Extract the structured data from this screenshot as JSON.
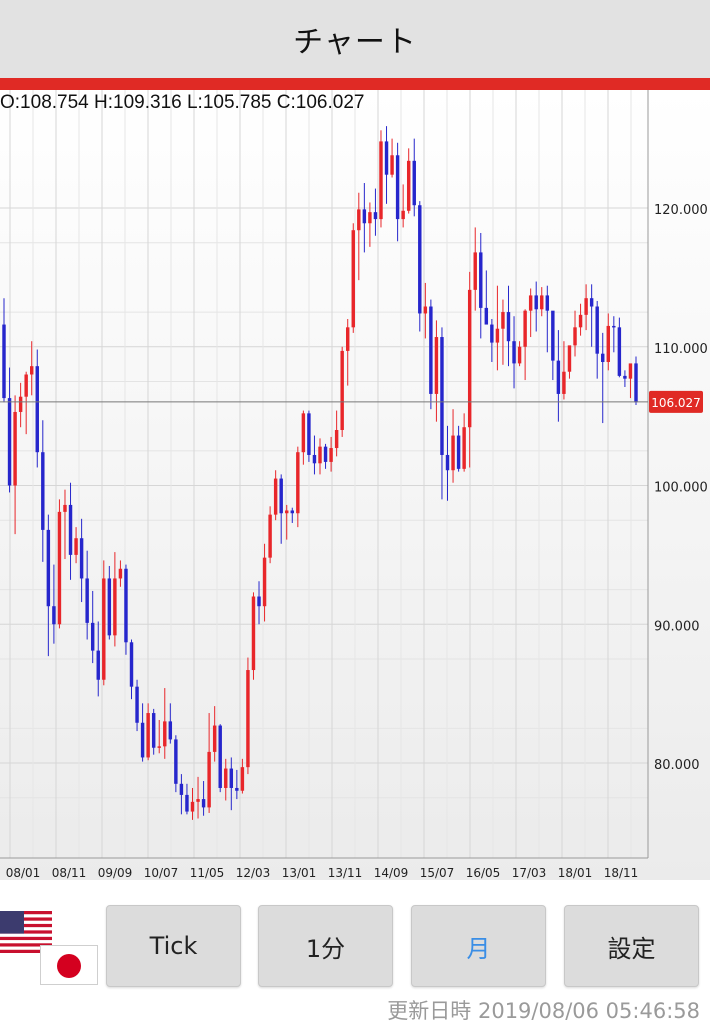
{
  "header": {
    "title": "チャート"
  },
  "ohlc_text": "O:108.754 H:109.316 L:105.785 C:106.027",
  "buttons": [
    {
      "label": "Tick",
      "active": false
    },
    {
      "label": "1分",
      "active": false
    },
    {
      "label": "月",
      "active": true
    },
    {
      "label": "設定",
      "active": false
    }
  ],
  "updated_text": "更新日時  2019/08/06 05:46:58",
  "flags": {
    "base": "us-flag-icon",
    "quote": "jp-flag-icon"
  },
  "colors": {
    "accent_red": "#e02a25",
    "up": "#e8262a",
    "down": "#2626cc",
    "active_button": "#3a8ee6"
  },
  "chart_data": {
    "type": "candlestick",
    "current_price_label": "106.027",
    "current_price": 106.027,
    "y_ticks": [
      "120.000",
      "110.000",
      "100.000",
      "90.000",
      "80.000"
    ],
    "y_tick_values": [
      120,
      110,
      100,
      90,
      80
    ],
    "ylim": [
      73.8,
      127
    ],
    "x_tick_labels": [
      "08/01",
      "08/11",
      "09/09",
      "10/07",
      "11/05",
      "12/03",
      "13/01",
      "13/11",
      "14/09",
      "15/07",
      "16/05",
      "17/03",
      "18/01",
      "18/11"
    ],
    "grid": true,
    "candles": [
      [
        111.6,
        113.5,
        106.0,
        106.3
      ],
      [
        106.3,
        108.5,
        99.5,
        100.0
      ],
      [
        100.0,
        106.5,
        96.5,
        105.3
      ],
      [
        105.3,
        107.4,
        104.2,
        106.4
      ],
      [
        106.4,
        108.2,
        103.7,
        108.0
      ],
      [
        108.0,
        110.4,
        106.5,
        108.6
      ],
      [
        108.6,
        109.8,
        101.3,
        102.4
      ],
      [
        102.4,
        104.7,
        94.5,
        96.8
      ],
      [
        96.8,
        97.9,
        87.7,
        91.3
      ],
      [
        91.3,
        94.3,
        88.6,
        90.0
      ],
      [
        90.0,
        99.0,
        89.7,
        98.1
      ],
      [
        98.1,
        99.7,
        94.7,
        98.6
      ],
      [
        98.6,
        100.2,
        93.2,
        95.0
      ],
      [
        95.0,
        97.0,
        94.4,
        96.2
      ],
      [
        96.2,
        97.6,
        91.6,
        93.3
      ],
      [
        93.3,
        95.3,
        88.9,
        90.1
      ],
      [
        90.1,
        92.4,
        87.2,
        88.1
      ],
      [
        88.1,
        90.2,
        84.8,
        86.0
      ],
      [
        86.0,
        94.6,
        85.6,
        93.3
      ],
      [
        93.3,
        94.2,
        88.9,
        89.2
      ],
      [
        89.2,
        95.2,
        88.4,
        93.3
      ],
      [
        93.3,
        94.6,
        92.7,
        94.0
      ],
      [
        94.0,
        94.3,
        87.8,
        88.7
      ],
      [
        88.7,
        88.9,
        84.6,
        85.5
      ],
      [
        85.5,
        86.0,
        82.3,
        82.9
      ],
      [
        82.9,
        84.3,
        80.1,
        80.4
      ],
      [
        80.4,
        84.3,
        80.2,
        83.6
      ],
      [
        83.6,
        83.9,
        80.6,
        81.1
      ],
      [
        81.1,
        83.1,
        80.7,
        81.2
      ],
      [
        81.2,
        85.4,
        80.3,
        83.0
      ],
      [
        83.0,
        84.3,
        81.4,
        81.7
      ],
      [
        81.7,
        82.0,
        77.9,
        78.5
      ],
      [
        78.5,
        79.2,
        76.3,
        77.7
      ],
      [
        77.7,
        78.5,
        76.3,
        76.5
      ],
      [
        76.5,
        78.2,
        75.9,
        77.2
      ],
      [
        77.2,
        79.0,
        76.0,
        77.4
      ],
      [
        77.4,
        78.7,
        76.2,
        76.8
      ],
      [
        76.8,
        83.6,
        76.4,
        80.8
      ],
      [
        80.8,
        84.1,
        80.1,
        82.7
      ],
      [
        82.7,
        82.8,
        77.9,
        78.2
      ],
      [
        78.2,
        80.3,
        77.3,
        79.6
      ],
      [
        79.6,
        80.4,
        76.6,
        78.2
      ],
      [
        78.2,
        79.5,
        77.4,
        78.0
      ],
      [
        78.0,
        80.3,
        77.8,
        79.7
      ],
      [
        79.7,
        87.6,
        79.2,
        86.7
      ],
      [
        86.7,
        92.3,
        86.0,
        92.0
      ],
      [
        92.0,
        93.1,
        90.0,
        91.3
      ],
      [
        91.3,
        95.8,
        90.2,
        94.8
      ],
      [
        94.8,
        98.5,
        94.4,
        97.9
      ],
      [
        97.9,
        101.1,
        97.5,
        100.5
      ],
      [
        100.5,
        100.8,
        95.8,
        98.0
      ],
      [
        98.0,
        98.6,
        96.1,
        98.2
      ],
      [
        98.2,
        98.4,
        97.3,
        98.0
      ],
      [
        98.0,
        102.8,
        97.0,
        102.4
      ],
      [
        102.4,
        105.4,
        101.5,
        105.2
      ],
      [
        105.2,
        105.4,
        101.7,
        102.2
      ],
      [
        102.2,
        103.6,
        100.8,
        101.6
      ],
      [
        101.6,
        103.4,
        100.8,
        102.8
      ],
      [
        102.8,
        103.0,
        101.2,
        101.7
      ],
      [
        101.7,
        103.5,
        101.0,
        102.7
      ],
      [
        102.7,
        105.4,
        102.1,
        104.0
      ],
      [
        104.0,
        110.0,
        103.5,
        109.7
      ],
      [
        109.7,
        112.0,
        107.2,
        111.4
      ],
      [
        111.4,
        118.9,
        111.0,
        118.4
      ],
      [
        118.4,
        121.1,
        114.8,
        119.9
      ],
      [
        119.9,
        121.8,
        116.8,
        118.9
      ],
      [
        118.9,
        120.4,
        117.2,
        119.7
      ],
      [
        119.7,
        121.4,
        118.0,
        119.2
      ],
      [
        119.2,
        125.6,
        118.6,
        124.8
      ],
      [
        124.8,
        125.9,
        120.3,
        122.4
      ],
      [
        122.4,
        125.0,
        122.2,
        123.8
      ],
      [
        123.8,
        124.7,
        117.6,
        119.2
      ],
      [
        119.2,
        121.7,
        118.6,
        119.8
      ],
      [
        119.8,
        124.3,
        119.6,
        123.4
      ],
      [
        123.4,
        125.0,
        119.4,
        120.2
      ],
      [
        120.2,
        120.5,
        111.1,
        112.4
      ],
      [
        112.4,
        114.6,
        110.6,
        112.9
      ],
      [
        112.9,
        113.4,
        105.5,
        106.6
      ],
      [
        106.6,
        111.9,
        104.6,
        110.7
      ],
      [
        110.7,
        111.4,
        99.0,
        102.2
      ],
      [
        102.2,
        104.3,
        98.9,
        101.1
      ],
      [
        101.1,
        105.5,
        100.2,
        103.6
      ],
      [
        103.6,
        104.3,
        101.0,
        101.2
      ],
      [
        101.2,
        105.2,
        101.0,
        104.2
      ],
      [
        104.2,
        115.4,
        101.3,
        114.1
      ],
      [
        114.1,
        118.6,
        112.6,
        116.8
      ],
      [
        116.8,
        118.2,
        110.6,
        112.8
      ],
      [
        112.8,
        115.5,
        111.7,
        111.6
      ],
      [
        111.6,
        112.0,
        108.9,
        110.3
      ],
      [
        110.3,
        114.4,
        108.3,
        111.3
      ],
      [
        111.3,
        113.4,
        108.7,
        112.5
      ],
      [
        112.5,
        114.4,
        108.6,
        110.4
      ],
      [
        110.4,
        112.2,
        107.0,
        108.8
      ],
      [
        108.8,
        110.4,
        108.6,
        110.0
      ],
      [
        110.0,
        112.7,
        107.6,
        112.6
      ],
      [
        112.6,
        114.2,
        110.7,
        113.7
      ],
      [
        113.7,
        114.7,
        111.1,
        112.7
      ],
      [
        112.7,
        114.3,
        112.2,
        113.7
      ],
      [
        113.7,
        114.4,
        109.6,
        112.6
      ],
      [
        112.6,
        112.4,
        107.6,
        109.0
      ],
      [
        109.0,
        111.2,
        104.6,
        106.6
      ],
      [
        106.6,
        110.4,
        106.2,
        108.2
      ],
      [
        108.2,
        110.0,
        107.7,
        110.1
      ],
      [
        110.1,
        112.6,
        109.3,
        111.4
      ],
      [
        111.4,
        113.1,
        110.8,
        112.3
      ],
      [
        112.3,
        114.5,
        111.2,
        113.5
      ],
      [
        113.5,
        114.5,
        110.0,
        112.9
      ],
      [
        112.9,
        113.3,
        107.7,
        109.5
      ],
      [
        109.5,
        111.0,
        104.5,
        108.9
      ],
      [
        108.9,
        112.4,
        108.3,
        111.5
      ],
      [
        111.5,
        112.2,
        109.6,
        111.4
      ],
      [
        111.4,
        112.1,
        107.8,
        107.9
      ],
      [
        107.9,
        108.3,
        107.1,
        107.7
      ],
      [
        107.7,
        108.5,
        106.3,
        108.8
      ],
      [
        108.8,
        109.3,
        105.8,
        106.0
      ]
    ]
  }
}
